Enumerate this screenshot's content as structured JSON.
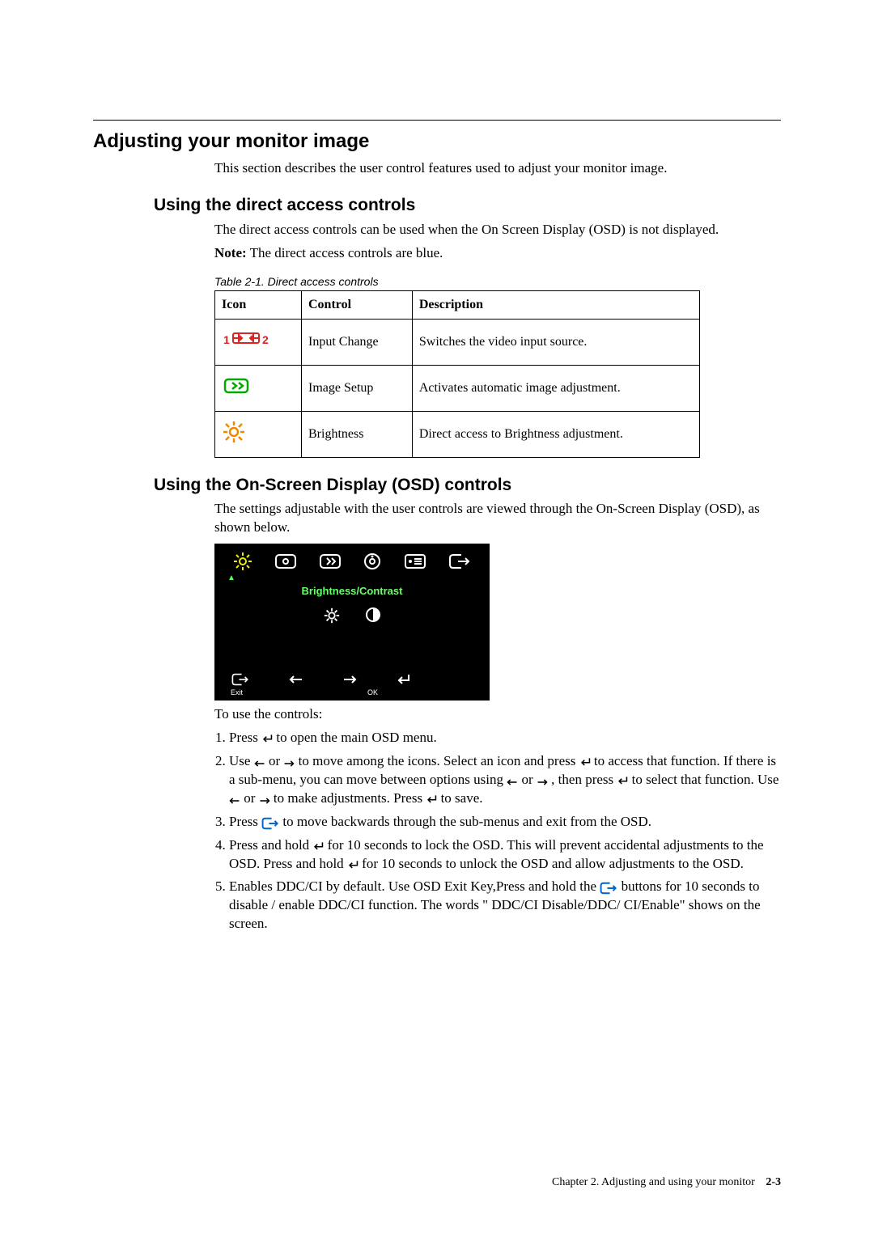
{
  "headings": {
    "h1": "Adjusting your monitor image",
    "h2a": "Using the direct access controls",
    "h2b": "Using the On-Screen Display (OSD) controls"
  },
  "text": {
    "intro1": "This section describes the user control features used to adjust your monitor image.",
    "intro2": "The direct access controls can be used when the On Screen Display (OSD) is not displayed.",
    "note_label": "Note:",
    "note_body": " The direct access controls are blue.",
    "table_caption": "Table 2-1. Direct access controls",
    "osd_intro": "The settings adjustable with the user controls are viewed through the On-Screen Display (OSD), as shown below.",
    "to_use": "To use the controls:"
  },
  "table": {
    "h_icon": "Icon",
    "h_control": "Control",
    "h_desc": "Description",
    "rows": [
      {
        "control": "Input Change",
        "desc": "Switches the video input source."
      },
      {
        "control": "Image Setup",
        "desc": "Activates automatic image adjustment."
      },
      {
        "control": "Brightness",
        "desc": "Direct access to Brightness adjustment."
      }
    ]
  },
  "osd": {
    "title": "Brightness/Contrast",
    "exit": "Exit",
    "ok": "OK"
  },
  "steps": {
    "s1a": "Press ",
    "s1b": " to open the main OSD menu.",
    "s2a": "Use ",
    "s2b": " or ",
    "s2c": " to move among the icons. Select an icon and press ",
    "s2d": " to access that function. If there is a sub-menu, you can move between options using ",
    "s2e": " or ",
    "s2f": " , then press ",
    "s2g": " to select that function. Use ",
    "s2h": " or ",
    "s2i": " to make adjustments. Press ",
    "s2j": " to save.",
    "s3a": "Press ",
    "s3b": " to move backwards through the sub-menus and exit from the OSD.",
    "s4a": "Press and hold ",
    "s4b": " for 10 seconds to lock the OSD. This will prevent accidental adjustments to the OSD. Press and hold ",
    "s4c": " for 10 seconds to unlock the OSD and allow adjustments to the OSD.",
    "s5a": "Enables DDC/CI by default. Use OSD Exit Key,Press and hold the ",
    "s5b": " buttons for 10 seconds to disable / enable DDC/CI function. The words \" DDC/CI Disable/DDC/ CI/Enable\" shows on the screen."
  },
  "footer": {
    "chapter": "Chapter 2. Adjusting and using your monitor",
    "page": "2-3"
  }
}
